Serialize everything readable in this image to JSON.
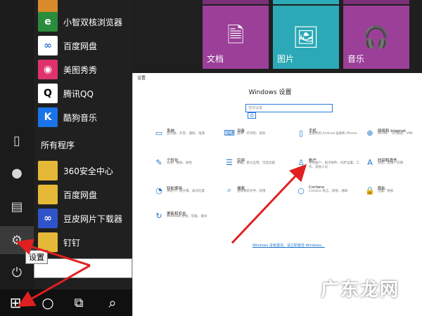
{
  "start_menu": {
    "rail": [
      {
        "name": "documents-rail-icon",
        "glyph": "▯"
      },
      {
        "name": "user-rail-icon",
        "glyph": "●"
      },
      {
        "name": "file-explorer-rail-icon",
        "glyph": "▤"
      },
      {
        "name": "settings-gear-icon",
        "glyph": "⚙"
      },
      {
        "name": "power-icon",
        "glyph": "⏻"
      }
    ],
    "apps_top": [
      {
        "label": "",
        "color": "#d98a2b",
        "glyph": ""
      },
      {
        "label": "小智双核浏览器",
        "color": "#2a8c3c",
        "glyph": "e"
      },
      {
        "label": "百度网盘",
        "color": "#ffffff",
        "glyph": "∞"
      },
      {
        "label": "美图秀秀",
        "color": "#e0336b",
        "glyph": "◉"
      },
      {
        "label": "腾讯QQ",
        "color": "#ffffff",
        "glyph": "Q"
      },
      {
        "label": "酷狗音乐",
        "color": "#1a73e8",
        "glyph": "K"
      }
    ],
    "section_header": "所有程序",
    "apps_all": [
      {
        "label": "360安全中心",
        "color": "#e6b838",
        "glyph": ""
      },
      {
        "label": "百度网盘",
        "color": "#e6b838",
        "glyph": ""
      },
      {
        "label": "豆皮网片下载器",
        "color": "#2f53c9",
        "glyph": "∞"
      },
      {
        "label": "钉钉",
        "color": "#e6b838",
        "glyph": ""
      }
    ],
    "tooltip": "设置"
  },
  "taskbar": {
    "buttons": [
      {
        "name": "start-button",
        "glyph": "⊞"
      },
      {
        "name": "cortana-button",
        "glyph": "○"
      },
      {
        "name": "task-view-button",
        "glyph": "⧉"
      },
      {
        "name": "search-taskbar-button",
        "glyph": "⌕"
      }
    ]
  },
  "tiles": [
    {
      "label": "文档",
      "color": "#9b3f98",
      "glyph": "🗎"
    },
    {
      "label": "图片",
      "color": "#2ca9b6",
      "glyph": "🖼"
    },
    {
      "label": "音乐",
      "color": "#9b3f98",
      "glyph": "🎧"
    }
  ],
  "settings": {
    "window_title": "设置",
    "heading": "Windows 设置",
    "search_placeholder": "查找设置",
    "ime_label": "中",
    "items": [
      {
        "title": "系统",
        "desc": "显示器、声音、通知、电源",
        "glyph": "▭"
      },
      {
        "title": "设备",
        "desc": "蓝牙、打印机、鼠标",
        "glyph": "⌨"
      },
      {
        "title": "手机",
        "desc": "连接你的 Android 设备和 iPhone",
        "glyph": "▯"
      },
      {
        "title": "网络和 Internet",
        "desc": "WLAN、飞行模式、VPN",
        "glyph": "⊕"
      },
      {
        "title": "个性化",
        "desc": "背景、锁屏、颜色",
        "glyph": "✎"
      },
      {
        "title": "应用",
        "desc": "卸载、默认应用、可选功能",
        "glyph": "☰"
      },
      {
        "title": "帐户",
        "desc": "你的帐户、电子邮件、同步设置、工作、其他人员",
        "glyph": "♙"
      },
      {
        "title": "时间和语言",
        "desc": "语音、区域、日期",
        "glyph": "A"
      },
      {
        "title": "轻松使用",
        "desc": "讲述人、放大镜、高对比度",
        "glyph": "◔"
      },
      {
        "title": "搜索",
        "desc": "查找我的文件、权限",
        "glyph": "⌕"
      },
      {
        "title": "Cortana",
        "desc": "Cortana 语言、权限、通知",
        "glyph": "○"
      },
      {
        "title": "隐私",
        "desc": "位置、相机",
        "glyph": "🔒"
      },
      {
        "title": "更新和安全",
        "desc": "Windows 更新、恢复、备份",
        "glyph": "↻"
      }
    ],
    "activate_link": "Windows 没有激活，请立即激活 Windows。"
  },
  "watermark": "广东龙网"
}
